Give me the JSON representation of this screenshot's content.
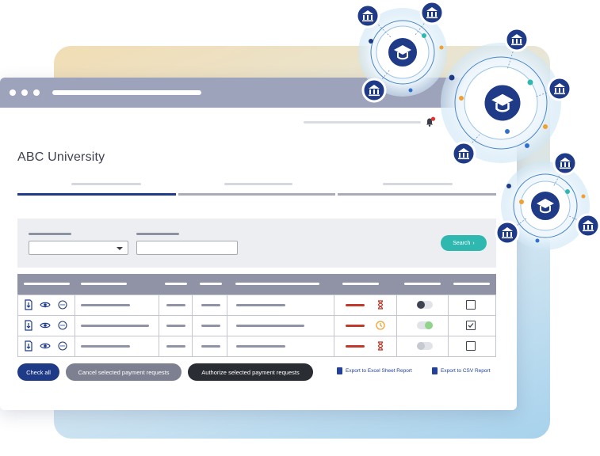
{
  "app": {
    "title": "ABC University",
    "notification_count": "1"
  },
  "filter": {
    "search_label": "Search",
    "search_arrow": "›"
  },
  "rows": [
    {
      "status": "pending",
      "toggle_on": false,
      "checked": false
    },
    {
      "status": "scheduled",
      "toggle_on": true,
      "checked": true
    },
    {
      "status": "pending",
      "toggle_on": false,
      "checked": false
    }
  ],
  "actions": {
    "check_all": "Check all",
    "cancel": "Cancel selected payment requests",
    "authorize": "Authorize selected payment requests",
    "export_excel": "Export to Excel Sheet Report",
    "export_csv": "Export to CSV Report"
  },
  "colors": {
    "primary": "#1f3b87",
    "teal": "#2fb8b0",
    "header_gray": "#8f93a5",
    "dark_button": "#2b2d35",
    "gray_button": "#7d8090",
    "status_red": "#c0392b",
    "status_orange": "#f0a030",
    "toggle_green": "#8fd48a"
  },
  "icons": [
    "download-icon",
    "eye-icon",
    "comment-icon",
    "hourglass-icon",
    "clock-icon",
    "bell-icon",
    "graduation-cap-icon",
    "bank-icon"
  ]
}
